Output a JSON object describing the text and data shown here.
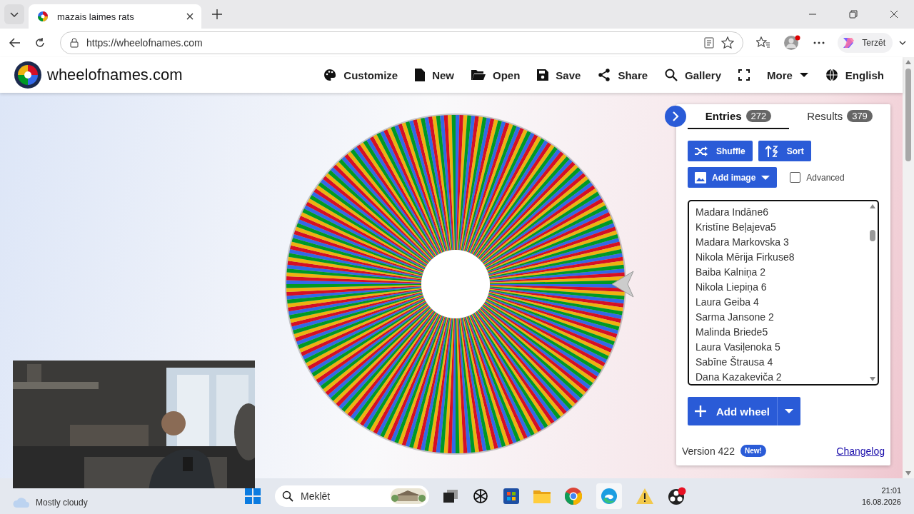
{
  "browser": {
    "tab": {
      "title": "mazais laimes rats"
    },
    "url": "https://wheelofnames.com",
    "copilot_label": "Terzēt"
  },
  "site": {
    "logo_text": "wheelofnames.com",
    "nav": [
      {
        "label": "Customize",
        "menu": false
      },
      {
        "label": "New",
        "menu": false
      },
      {
        "label": "Open",
        "menu": false
      },
      {
        "label": "Save",
        "menu": false
      },
      {
        "label": "Share",
        "menu": false
      },
      {
        "label": "Gallery",
        "menu": false
      },
      {
        "label": "More",
        "menu": true
      },
      {
        "label": "English",
        "menu": false
      }
    ]
  },
  "panel": {
    "tabs": [
      {
        "label": "Entries",
        "count": "272",
        "selected": true
      },
      {
        "label": "Results",
        "count": "379",
        "selected": false
      }
    ],
    "actions": [
      "Shuffle",
      "Sort"
    ],
    "add_image": "Add image",
    "advanced": {
      "label": "Advanced",
      "checked": false
    },
    "entries": [
      "Madara Indāne6",
      "Kristīne Beļajeva5",
      "Madara Markovska 3",
      "Nikola Mērija Firkuse8",
      "Baiba Kalniņa 2",
      "Nikola Liepiņa 6",
      "Laura Geiba 4",
      "Sarma Jansone 2",
      "Malinda Briede5",
      "Laura Vasiļenoka 5",
      "Sabīne Štrausa 4",
      "Dana Kazakeviča 2"
    ],
    "add_wheel": "Add wheel",
    "version": "Version 422",
    "new_badge": "New!",
    "changelog": "Changelog"
  },
  "taskbar": {
    "weather": "Mostly cloudy",
    "search_placeholder": "Meklēt",
    "time": "21:01",
    "date": "16.08.2026"
  }
}
